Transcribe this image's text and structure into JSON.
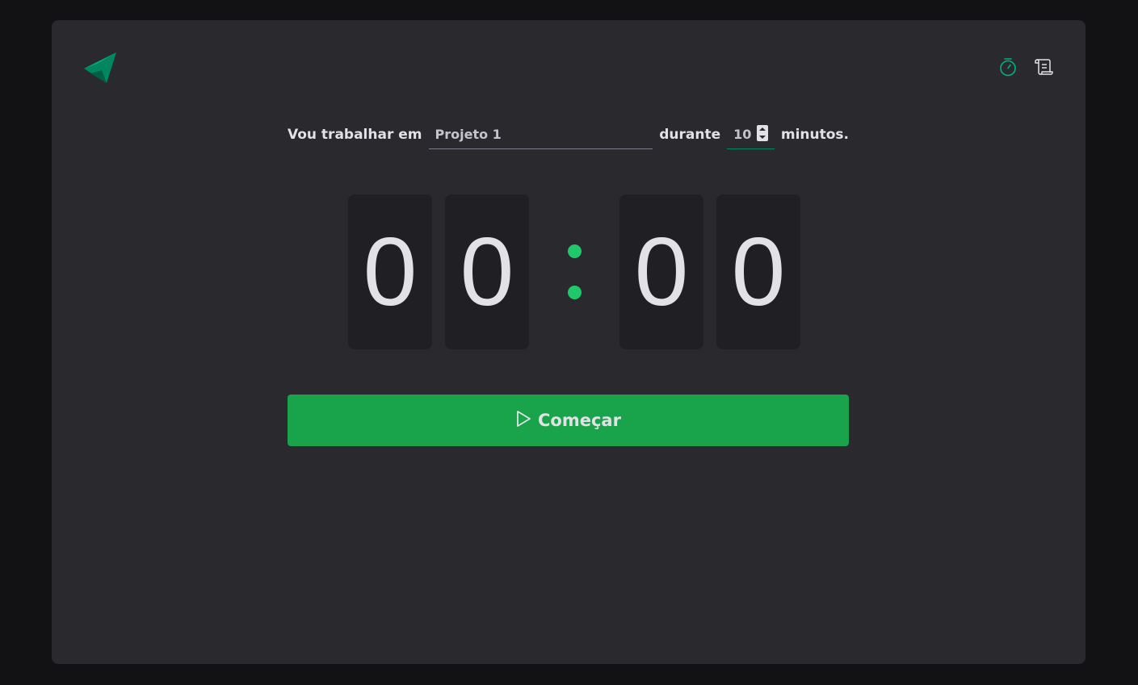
{
  "header": {
    "logo_icon": "triangle-logo-icon",
    "nav": [
      {
        "icon": "timer-icon",
        "color": "#00b37e"
      },
      {
        "icon": "scroll-icon",
        "color": "#e1e1e6"
      }
    ]
  },
  "form": {
    "task_label": "Vou trabalhar em",
    "task_value": "Projeto 1",
    "duration_label": "durante",
    "minutes_value": "10",
    "minutes_suffix": "minutos."
  },
  "countdown": {
    "minutes": [
      "0",
      "0"
    ],
    "seconds": [
      "0",
      "0"
    ],
    "separator_color": "#1fc96b"
  },
  "start_button": {
    "label": "Começar",
    "icon": "play-icon",
    "color": "#19a34b"
  }
}
